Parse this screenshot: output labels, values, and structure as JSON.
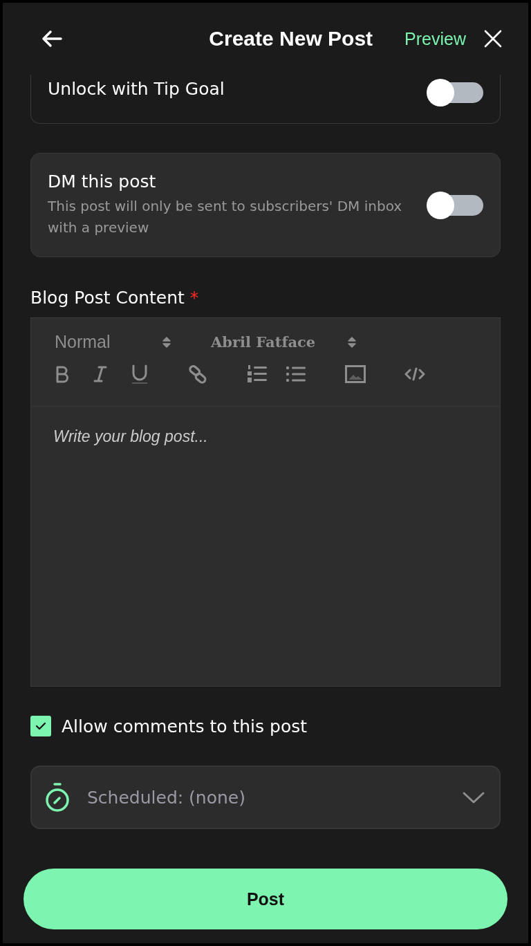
{
  "header": {
    "title": "Create New Post",
    "preview": "Preview"
  },
  "toggles": [
    {
      "title": "Unlock with Tip Goal",
      "on": false
    },
    {
      "title": "DM this post",
      "description": "This post will only be sent to subscribers' DM inbox with a preview",
      "on": false
    }
  ],
  "editor": {
    "label": "Blog Post Content",
    "required_mark": "*",
    "style_select": "Normal",
    "font_select": "Abril Fatface",
    "placeholder": "Write your blog post..."
  },
  "allow_comments": {
    "label": "Allow comments to this post",
    "checked": true
  },
  "schedule": {
    "value": "Scheduled: (none)"
  },
  "submit": {
    "label": "Post"
  }
}
